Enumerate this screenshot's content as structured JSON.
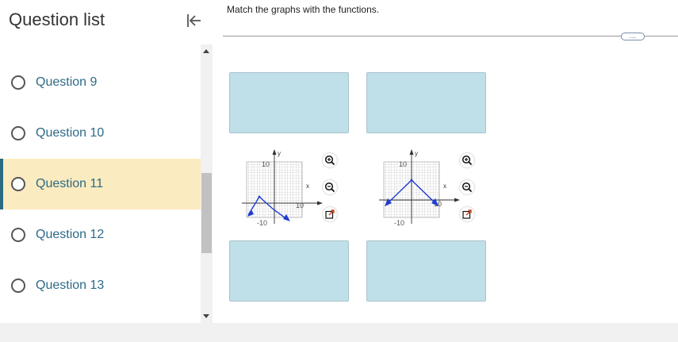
{
  "sidebar": {
    "title": "Question list",
    "items": [
      {
        "label": "Question 9",
        "active": false
      },
      {
        "label": "Question 10",
        "active": false
      },
      {
        "label": "Question 11",
        "active": true
      },
      {
        "label": "Question 12",
        "active": false
      },
      {
        "label": "Question 13",
        "active": false
      }
    ]
  },
  "main": {
    "instructions": "Match the graphs with the functions.",
    "more_label": "…"
  },
  "graphs": [
    {
      "y_tick_top": "10",
      "x_tick_right": "10",
      "x_tick_left": "-10",
      "y_axis_name": "y",
      "x_axis_name": "x",
      "shape": "inverted-v-shifted-left-down"
    },
    {
      "y_tick_top": "10",
      "x_tick_right": "10",
      "x_tick_left": "-10",
      "y_axis_name": "y",
      "x_axis_name": "x",
      "shape": "inverted-v"
    }
  ],
  "colors": {
    "accent": "#2b6a7f",
    "active_bg": "#fbebc0",
    "drop_zone": "#bfdfe9",
    "link": "#2d6a86",
    "graph_line": "#1f3bd1"
  },
  "icons": [
    "collapse-sidebar-icon",
    "zoom-in-icon",
    "zoom-out-icon",
    "open-external-icon",
    "more-options-icon"
  ]
}
